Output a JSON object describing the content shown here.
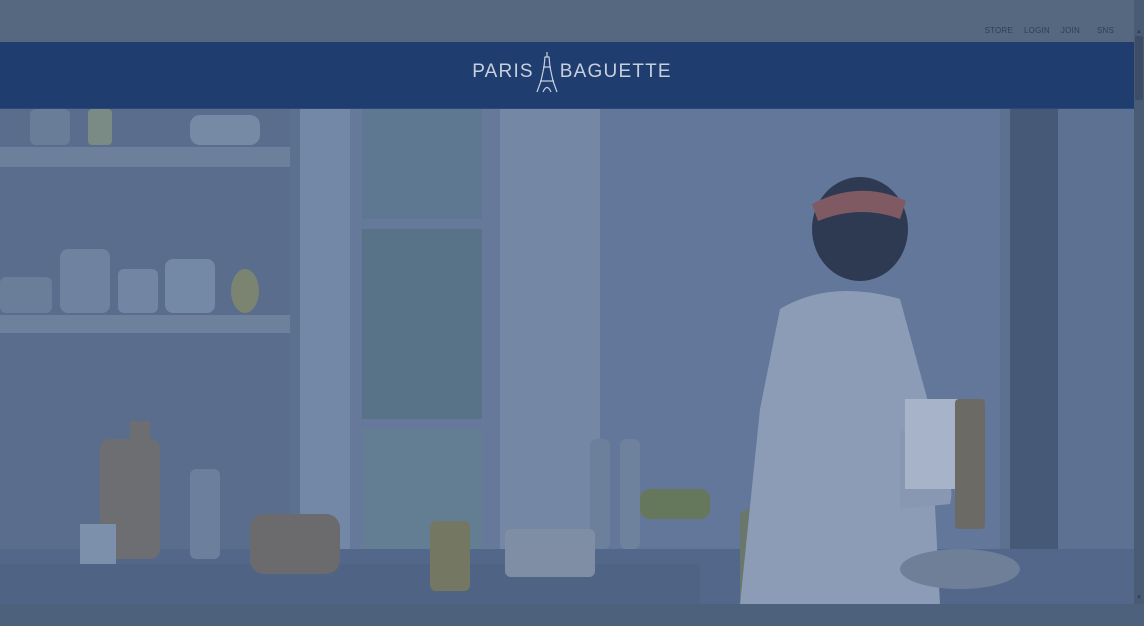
{
  "util_nav": {
    "store": "STORE",
    "login": "LOGIN",
    "join": "JOIN",
    "sns": "SNS"
  },
  "header": {
    "logo_left": "PARIS",
    "logo_right": "BAGUETTE",
    "logo_icon": "eiffel-tower-icon"
  },
  "hero": {
    "description_icon": "kitchen-photo"
  },
  "colors": {
    "header_bg": "#1f3d6e",
    "overlay": "#4f627f",
    "logo_text": "#c7d0df"
  }
}
